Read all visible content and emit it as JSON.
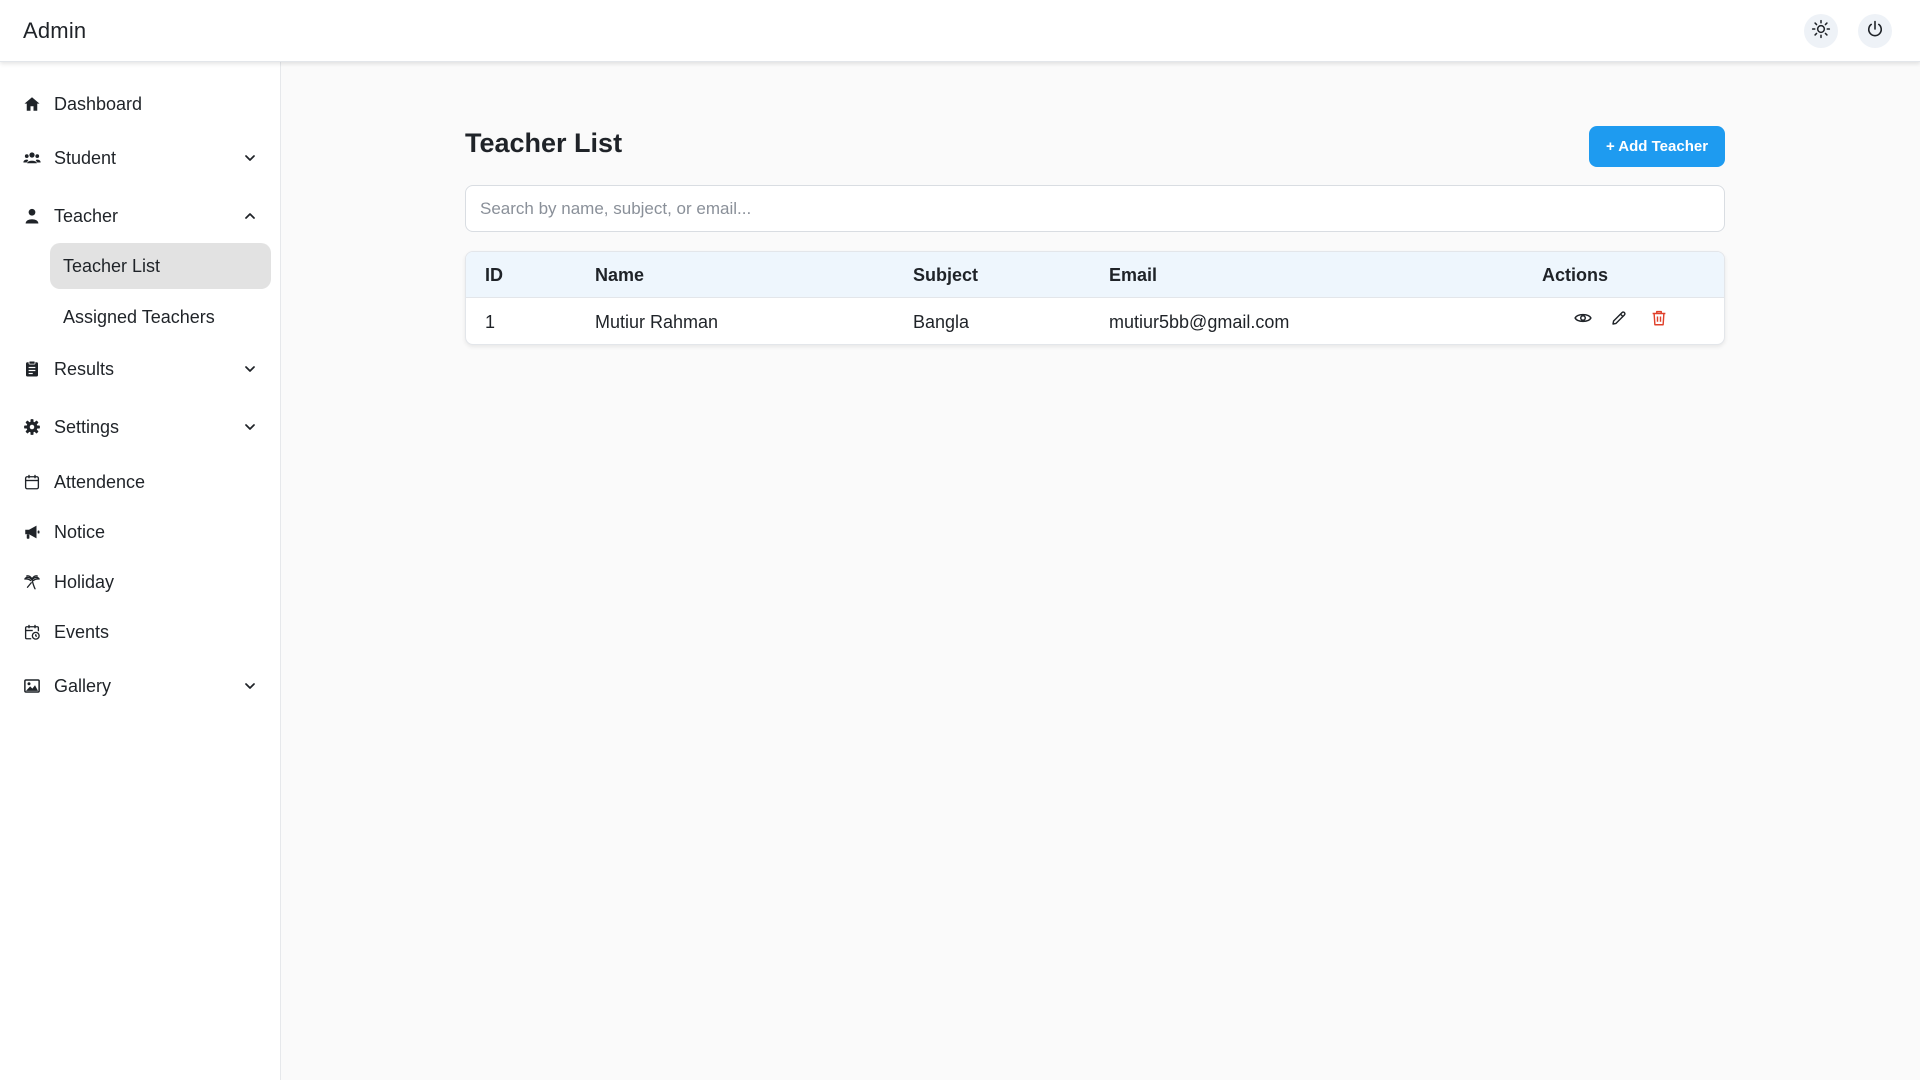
{
  "app": {
    "brand": "Admin"
  },
  "topbar": {
    "theme_icon": "sun-icon",
    "power_icon": "power-icon"
  },
  "sidebar": {
    "items": [
      {
        "label": "Dashboard",
        "icon": "home-icon"
      },
      {
        "label": "Student",
        "icon": "users-icon",
        "chevron": "down"
      },
      {
        "label": "Teacher",
        "icon": "user-icon",
        "chevron": "up",
        "children": [
          {
            "label": "Teacher List",
            "active": true
          },
          {
            "label": "Assigned Teachers",
            "active": false
          }
        ]
      },
      {
        "label": "Results",
        "icon": "clipboard-icon",
        "chevron": "down"
      },
      {
        "label": "Settings",
        "icon": "gear-icon",
        "chevron": "down"
      },
      {
        "label": "Attendence",
        "icon": "calendar-icon"
      },
      {
        "label": "Notice",
        "icon": "megaphone-icon"
      },
      {
        "label": "Holiday",
        "icon": "palm-tree-icon"
      },
      {
        "label": "Events",
        "icon": "calendar-clock-icon"
      },
      {
        "label": "Gallery",
        "icon": "image-icon",
        "chevron": "down"
      }
    ]
  },
  "main": {
    "title": "Teacher List",
    "add_button": "+ Add Teacher",
    "search_placeholder": "Search by name, subject, or email...",
    "table": {
      "columns": [
        "ID",
        "Name",
        "Subject",
        "Email",
        "Actions"
      ],
      "rows": [
        {
          "id": "1",
          "name": "Mutiur Rahman",
          "subject": "Bangla",
          "email": "mutiur5bb@gmail.com",
          "actions": [
            "eye-icon",
            "pencil-icon",
            "trash-icon"
          ]
        }
      ]
    }
  },
  "colors": {
    "accent": "#1e9bf0",
    "danger": "#e0402a",
    "active_bg": "#e2e2e2",
    "table_header_bg": "#eef6fd"
  }
}
